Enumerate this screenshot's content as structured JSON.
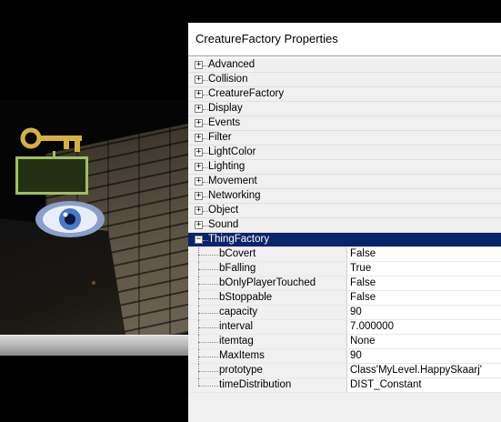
{
  "window": {
    "title": "CreatureFactory Properties"
  },
  "categories": [
    {
      "label": "Advanced",
      "expanded": false
    },
    {
      "label": "Collision",
      "expanded": false
    },
    {
      "label": "CreatureFactory",
      "expanded": false
    },
    {
      "label": "Display",
      "expanded": false
    },
    {
      "label": "Events",
      "expanded": false
    },
    {
      "label": "Filter",
      "expanded": false
    },
    {
      "label": "LightColor",
      "expanded": false
    },
    {
      "label": "Lighting",
      "expanded": false
    },
    {
      "label": "Movement",
      "expanded": false
    },
    {
      "label": "Networking",
      "expanded": false
    },
    {
      "label": "Object",
      "expanded": false
    },
    {
      "label": "Sound",
      "expanded": false
    },
    {
      "label": "ThingFactory",
      "expanded": true
    }
  ],
  "expander_symbols": {
    "collapsed": "+",
    "expanded": "−"
  },
  "properties": [
    {
      "name": "bCovert",
      "value": "False"
    },
    {
      "name": "bFalling",
      "value": "True"
    },
    {
      "name": "bOnlyPlayerTouched",
      "value": "False"
    },
    {
      "name": "bStoppable",
      "value": "False"
    },
    {
      "name": "capacity",
      "value": "90"
    },
    {
      "name": "interval",
      "value": "7.000000"
    },
    {
      "name": "itemtag",
      "value": "None"
    },
    {
      "name": "MaxItems",
      "value": "90"
    },
    {
      "name": "prototype",
      "value": "Class'MyLevel.HappySkaarj'"
    },
    {
      "name": "timeDistribution",
      "value": "DIST_Constant"
    }
  ],
  "colors": {
    "selection": "#0a246a",
    "key_gold": "#d8b040",
    "label_box_border": "#9fbf5f",
    "eye_blue": "#4a78c8"
  },
  "viewport_icons": [
    "key-icon",
    "eye-icon"
  ]
}
